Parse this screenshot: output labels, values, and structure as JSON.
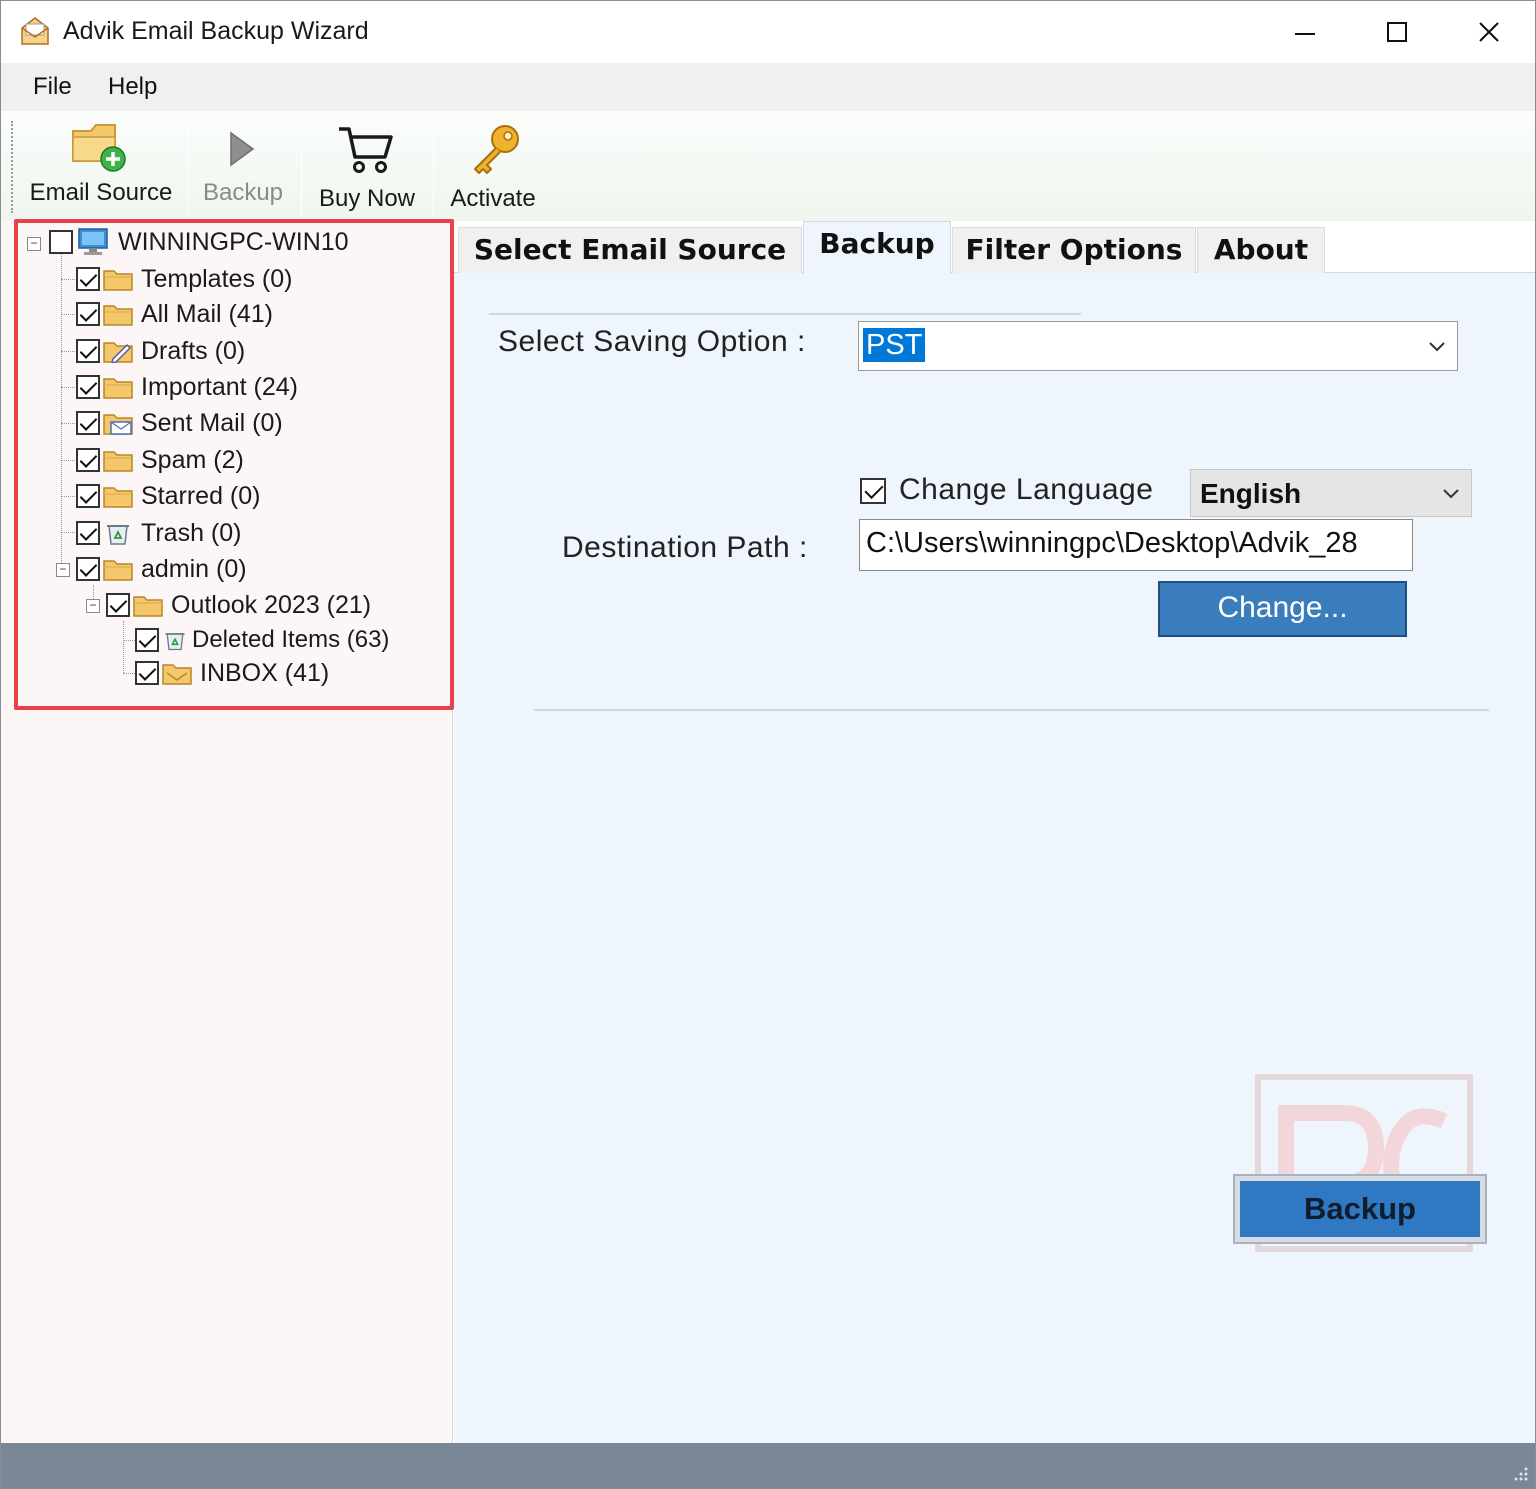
{
  "window": {
    "title": "Advik Email Backup Wizard"
  },
  "menu": {
    "file": "File",
    "help": "Help"
  },
  "toolbar": {
    "email_source": "Email Source",
    "backup": "Backup",
    "buy_now": "Buy Now",
    "activate": "Activate"
  },
  "tree": {
    "root": "WINNINGPC-WIN10",
    "items": [
      {
        "label": "Templates (0)"
      },
      {
        "label": "All Mail (41)"
      },
      {
        "label": "Drafts (0)"
      },
      {
        "label": "Important (24)"
      },
      {
        "label": "Sent Mail (0)"
      },
      {
        "label": "Spam (2)"
      },
      {
        "label": "Starred (0)"
      },
      {
        "label": "Trash (0)"
      },
      {
        "label": "admin (0)"
      },
      {
        "label": "Outlook 2023 (21)"
      },
      {
        "label": "Deleted Items (63)"
      },
      {
        "label": "INBOX (41)"
      }
    ]
  },
  "tabs": {
    "select_email_source": "Select Email Source",
    "backup": "Backup",
    "filter_options": "Filter Options",
    "about": "About",
    "active": "Backup"
  },
  "backup_tab": {
    "saving_option_label": "Select Saving Option :",
    "saving_option_value": "PST",
    "change_language_label": "Change Language",
    "change_language_checked": true,
    "language_value": "English",
    "destination_label": "Destination Path :",
    "destination_value": "C:\\Users\\winningpc\\Desktop\\Advik_28",
    "change_button": "Change...",
    "backup_button": "Backup"
  },
  "colors": {
    "highlight": "#e8414a",
    "accent_button": "#3a7dbd",
    "status_bar": "#7a8797"
  }
}
